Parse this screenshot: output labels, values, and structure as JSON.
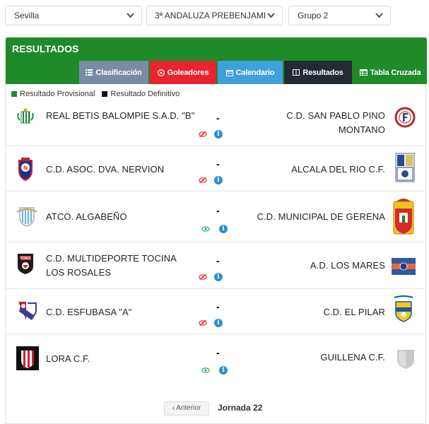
{
  "filters": {
    "province": "Sevilla",
    "category": "3ª ANDALUZA PREBENJAMI",
    "group": "Grupo 2"
  },
  "panel": {
    "title": "RESULTADOS",
    "tabs": [
      {
        "label": "Clasificación",
        "color": "#7a8ca5"
      },
      {
        "label": "Goleadores",
        "color": "#e8242f"
      },
      {
        "label": "Calendario",
        "color": "#3fa0de"
      },
      {
        "label": "Resultados",
        "color": "#222a33"
      },
      {
        "label": "Tabla Cruzada",
        "color": "#1e8a28"
      }
    ],
    "header_color": "#1e8a28"
  },
  "legend": {
    "provisional": "Resultado Provisional",
    "definitivo": "Resultado Definitivo",
    "provisional_color": "#1e8a28",
    "definitivo_color": "#111111"
  },
  "matches": [
    {
      "home": "REAL BETIS BALOMPIE S.A.D. \"B\"",
      "away": "C.D. SAN PABLO PINO MONTANO",
      "score": "-",
      "visibility": "hidden"
    },
    {
      "home": "C.D. ASOC. DVA. NERVION",
      "away": "ALCALA DEL RIO C.F.",
      "score": "-",
      "visibility": "hidden"
    },
    {
      "home": "ATCO. ALGABEÑO",
      "away": "C.D. MUNICIPAL DE GERENA",
      "score": "-",
      "visibility": "visible"
    },
    {
      "home": "C.D. MULTIDEPORTE TOCINA LOS ROSALES",
      "away": "A.D. LOS MARES",
      "score": "-",
      "visibility": "hidden"
    },
    {
      "home": "C.D. ESFUBASA \"A\"",
      "away": "C.D. EL PILAR",
      "score": "-",
      "visibility": "hidden"
    },
    {
      "home": "LORA C.F.",
      "away": "GUILLENA C.F.",
      "score": "-",
      "visibility": "visible"
    }
  ],
  "pager": {
    "prev": "Anterior",
    "jornada": "Jornada 22"
  }
}
